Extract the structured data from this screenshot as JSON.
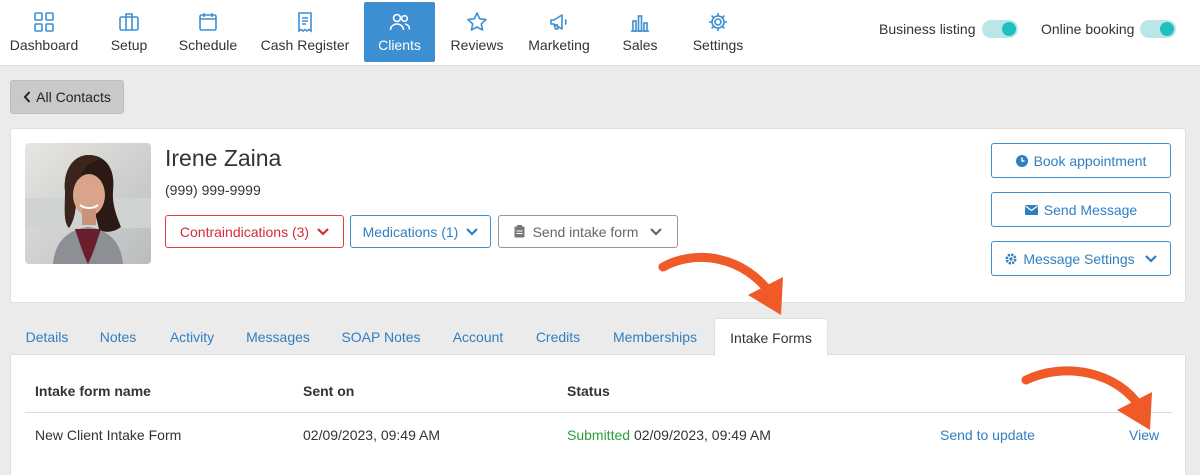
{
  "nav": {
    "items": [
      {
        "label": "Dashboard"
      },
      {
        "label": "Setup"
      },
      {
        "label": "Schedule"
      },
      {
        "label": "Cash Register"
      },
      {
        "label": "Clients"
      },
      {
        "label": "Reviews"
      },
      {
        "label": "Marketing"
      },
      {
        "label": "Sales"
      },
      {
        "label": "Settings"
      }
    ],
    "active": "Clients",
    "toggles": [
      {
        "label": "Business listing",
        "on": true
      },
      {
        "label": "Online booking",
        "on": true
      }
    ]
  },
  "back_button": {
    "label": "All Contacts"
  },
  "client": {
    "name": "Irene Zaina",
    "phone": "(999) 999-9999",
    "pills": {
      "contraindications": "Contraindications (3)",
      "medications": "Medications (1)",
      "intake": "Send intake form"
    },
    "actions": {
      "book": "Book appointment",
      "message": "Send Message",
      "settings": "Message Settings"
    }
  },
  "tabs": [
    {
      "label": "Details"
    },
    {
      "label": "Notes"
    },
    {
      "label": "Activity"
    },
    {
      "label": "Messages"
    },
    {
      "label": "SOAP Notes"
    },
    {
      "label": "Account"
    },
    {
      "label": "Credits"
    },
    {
      "label": "Memberships"
    },
    {
      "label": "Intake Forms"
    }
  ],
  "active_tab": "Intake Forms",
  "table": {
    "headers": {
      "name": "Intake form name",
      "sent": "Sent on",
      "status": "Status"
    },
    "rows": [
      {
        "name": "New Client Intake Form",
        "sent": "02/09/2023, 09:49 AM",
        "status": "Submitted",
        "status_date": "02/09/2023, 09:49 AM",
        "update_link": "Send to update",
        "view_link": "View"
      }
    ]
  },
  "colors": {
    "accent": "#3d8fd1",
    "danger": "#d42c3c",
    "success": "#2e9e3a",
    "toggle": "#1fbfbf",
    "arrow": "#f05a28"
  },
  "icons": [
    "dashboard-icon",
    "briefcase-icon",
    "calendar-icon",
    "receipt-icon",
    "users-icon",
    "star-icon",
    "megaphone-icon",
    "bar-chart-icon",
    "gear-icon",
    "chevron-left-icon",
    "chevron-down-icon",
    "clipboard-icon",
    "clock-icon",
    "envelope-icon"
  ]
}
